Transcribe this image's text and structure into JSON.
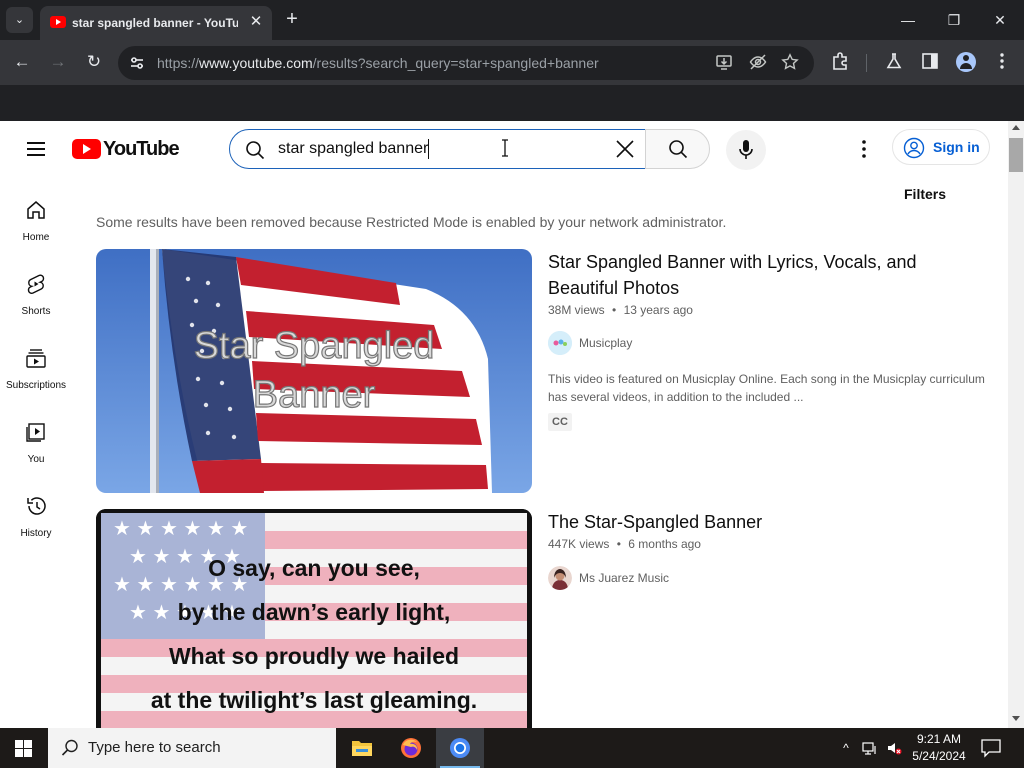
{
  "browser": {
    "tab": {
      "title": "star spangled banner - YouTube",
      "close": "✕"
    },
    "new_tab": "+",
    "tab_dropdown": "⌄",
    "window": {
      "minimize": "—",
      "restore": "❐",
      "close": "✕"
    },
    "nav": {
      "back": "←",
      "forward": "→",
      "reload": "↻"
    },
    "url_prefix": "https://",
    "url_host": "www.youtube.com",
    "url_path": "/results?search_query=star+spangled+banner"
  },
  "youtube": {
    "logo_text": "YouTube",
    "search": {
      "query": "star spangled banner"
    },
    "signin_label": "Sign in",
    "filters_label": "Filters",
    "guide": [
      {
        "label": "Home"
      },
      {
        "label": "Shorts"
      },
      {
        "label": "Subscriptions"
      },
      {
        "label": "You"
      },
      {
        "label": "History"
      }
    ],
    "notice": "Some results have been removed because Restricted Mode is enabled by your network administrator.",
    "results": [
      {
        "title": "Star Spangled Banner with Lyrics, Vocals, and Beautiful Photos",
        "views": "38M views",
        "age": "13 years ago",
        "channel": "Musicplay",
        "description": "This video is featured on Musicplay Online. Each song in the Musicplay curriculum has several videos, in addition to the included ...",
        "badge": "CC",
        "thumb_text_1": "Star Spangled",
        "thumb_text_2": "Banner"
      },
      {
        "title": "The Star-Spangled Banner",
        "views": "447K views",
        "age": "6 months ago",
        "channel": "Ms Juarez Music",
        "thumb_lines": [
          "O say, can you see,",
          "by the dawn’s early light,",
          "What so proudly we hailed",
          "at the twilight’s last gleaming."
        ]
      }
    ],
    "separator": "•"
  },
  "taskbar": {
    "search_placeholder": "Type here to search",
    "time": "9:21 AM",
    "date": "5/24/2024",
    "tray_chevron": "^"
  },
  "colors": {
    "youtube_red": "#ff0000",
    "link_blue": "#065fd4",
    "search_border": "#1c62b9",
    "chrome_dark": "#202124"
  }
}
